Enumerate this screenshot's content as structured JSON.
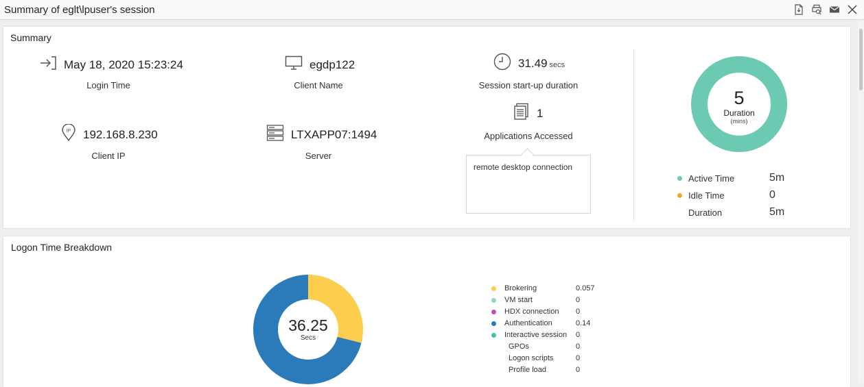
{
  "window": {
    "title": "Summary of eglt\\lpuser's session",
    "tools": [
      "export-pdf-icon",
      "print-preview-icon",
      "email-icon",
      "close-icon"
    ]
  },
  "summary": {
    "title": "Summary",
    "login_time": {
      "value": "May 18, 2020 15:23:24",
      "label": "Login Time"
    },
    "client_name": {
      "value": "egdp122",
      "label": "Client Name"
    },
    "startup": {
      "value": "31.49",
      "unit": "secs",
      "label": "Session start-up duration"
    },
    "client_ip": {
      "value": "192.168.8.230",
      "label": "Client IP"
    },
    "server": {
      "value": "LTXAPP07:1494",
      "label": "Server"
    },
    "apps": {
      "value": "1",
      "label": "Applications Accessed",
      "items": [
        "remote desktop connection"
      ]
    },
    "duration_donut": {
      "value": "5",
      "label": "Duration",
      "unit": "(mins)",
      "color": "#6cc9b2",
      "legend": [
        {
          "name": "Active Time",
          "value": "5m",
          "color": "#6cc9b2"
        },
        {
          "name": "Idle Time",
          "value": "0",
          "color": "#f5a623"
        },
        {
          "name": "Duration",
          "value": "5m",
          "color": ""
        }
      ]
    }
  },
  "logon": {
    "title": "Logon Time Breakdown",
    "total": "36.25",
    "total_unit": "Secs",
    "colors": {
      "brokering": "#fdcd4e",
      "authentication": "#2b7bba"
    },
    "breakdown": [
      {
        "name": "Brokering",
        "value": "0.057",
        "color": "#fdcd4e",
        "indent": false
      },
      {
        "name": "VM start",
        "value": "0",
        "color": "#8fd4c4",
        "indent": false
      },
      {
        "name": "HDX connection",
        "value": "0",
        "color": "#c44ab3",
        "indent": false
      },
      {
        "name": "Authentication",
        "value": "0.14",
        "color": "#2b7bba",
        "indent": false
      },
      {
        "name": "Interactive session",
        "value": "0",
        "color": "#3fbfb0",
        "indent": false
      },
      {
        "name": "GPOs",
        "value": "0",
        "color": "",
        "indent": true
      },
      {
        "name": "Logon scripts",
        "value": "0",
        "color": "",
        "indent": true
      },
      {
        "name": "Profile load",
        "value": "0",
        "color": "",
        "indent": true
      }
    ]
  }
}
